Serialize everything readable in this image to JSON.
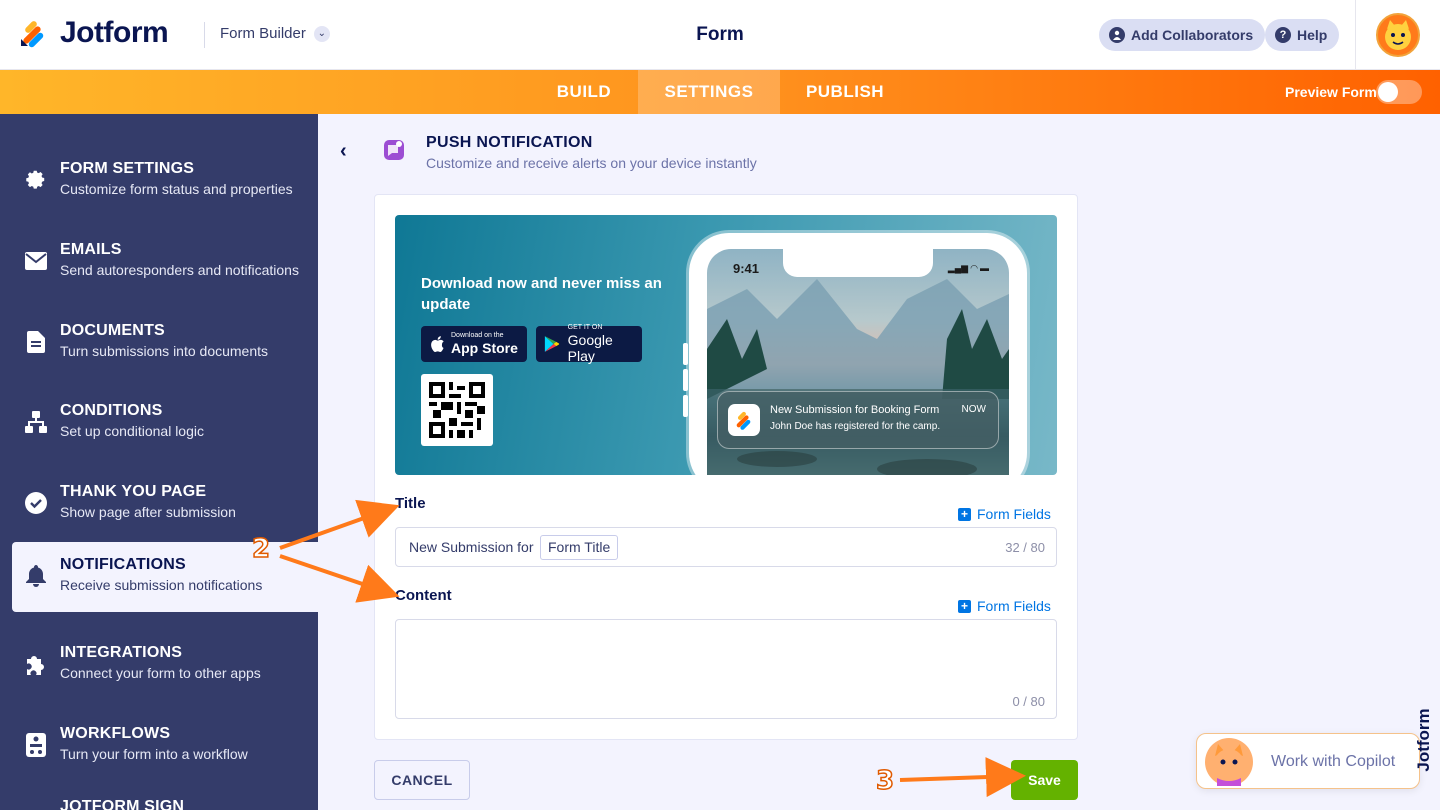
{
  "header": {
    "brand": "Jotform",
    "builder_select": "Form Builder",
    "form_title": "Form",
    "add_collaborators": "Add Collaborators",
    "help": "Help"
  },
  "nav": {
    "tabs": [
      {
        "label": "BUILD"
      },
      {
        "label": "SETTINGS"
      },
      {
        "label": "PUBLISH"
      }
    ],
    "active": "SETTINGS",
    "preview_label": "Preview Form",
    "preview_on": false
  },
  "sidebar": {
    "items": [
      {
        "title": "FORM SETTINGS",
        "sub": "Customize form status and properties",
        "icon": "gear-icon"
      },
      {
        "title": "EMAILS",
        "sub": "Send autoresponders and notifications",
        "icon": "envelope-icon"
      },
      {
        "title": "DOCUMENTS",
        "sub": "Turn submissions into documents",
        "icon": "document-icon"
      },
      {
        "title": "CONDITIONS",
        "sub": "Set up conditional logic",
        "icon": "hierarchy-icon"
      },
      {
        "title": "THANK YOU PAGE",
        "sub": "Show page after submission",
        "icon": "check-circle-icon"
      },
      {
        "title": "NOTIFICATIONS",
        "sub": "Receive submission notifications",
        "icon": "bell-icon"
      },
      {
        "title": "INTEGRATIONS",
        "sub": "Connect your form to other apps",
        "icon": "puzzle-icon"
      },
      {
        "title": "WORKFLOWS",
        "sub": "Turn your form into a workflow",
        "icon": "workflow-icon"
      },
      {
        "title": "JOTFORM SIGN",
        "sub": "",
        "icon": ""
      }
    ],
    "active_index": 5
  },
  "panel": {
    "title": "PUSH NOTIFICATION",
    "subtitle": "Customize and receive alerts on your device instantly"
  },
  "banner": {
    "headline": "Download now and never miss an update",
    "app_store_small": "Download on the",
    "app_store_big": "App Store",
    "play_small": "GET IT ON",
    "play_big": "Google Play",
    "phone_time": "9:41",
    "notification_title": "New Submission for Booking Form",
    "notification_time": "NOW",
    "notification_body": "John Doe has registered for the camp."
  },
  "fields": {
    "title_label": "Title",
    "title_prefix": "New Submission for",
    "title_chip": "Form Title",
    "title_counter": "32 / 80",
    "content_label": "Content",
    "content_counter": "0 / 80",
    "form_fields_link": "Form Fields"
  },
  "buttons": {
    "cancel": "CANCEL",
    "save": "Save"
  },
  "copilot": {
    "label": "Work with Copilot",
    "brand": "Jotform"
  },
  "annotations": {
    "step2": "2",
    "step3": "3"
  },
  "colors": {
    "navy": "#0a1551",
    "sidebar": "#343c6a",
    "orange": "#ff6100",
    "save_green": "#64b200",
    "link_blue": "#0075e3"
  }
}
